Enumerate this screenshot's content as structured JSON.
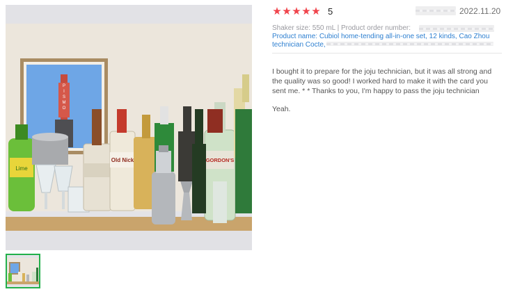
{
  "review": {
    "rating": {
      "stars": 5,
      "score_text": "5",
      "star_glyph": "★",
      "star_color": "#f0444c"
    },
    "date": "2022.11.20",
    "meta": {
      "size_line": "Shaker size: 550 mL | Product order number:",
      "product_name": "Product name: Cubiol home-tending all-in-one set, 12 kinds, Cao Zhou technician Cocte,"
    },
    "body": "I bought it to prepare for the joju technician, but it was all strong and the quality was so good! I worked hard to make it with the card you sent me. * * Thanks to you, I'm happy to pass the joju technician",
    "extra": "Yeah."
  },
  "gallery": {
    "selected_thumb_border": "#22b04b",
    "photo_label_sign": "PISMO",
    "bottle_labels": [
      "Old Nick",
      "GORDON'S",
      "Lime"
    ]
  }
}
